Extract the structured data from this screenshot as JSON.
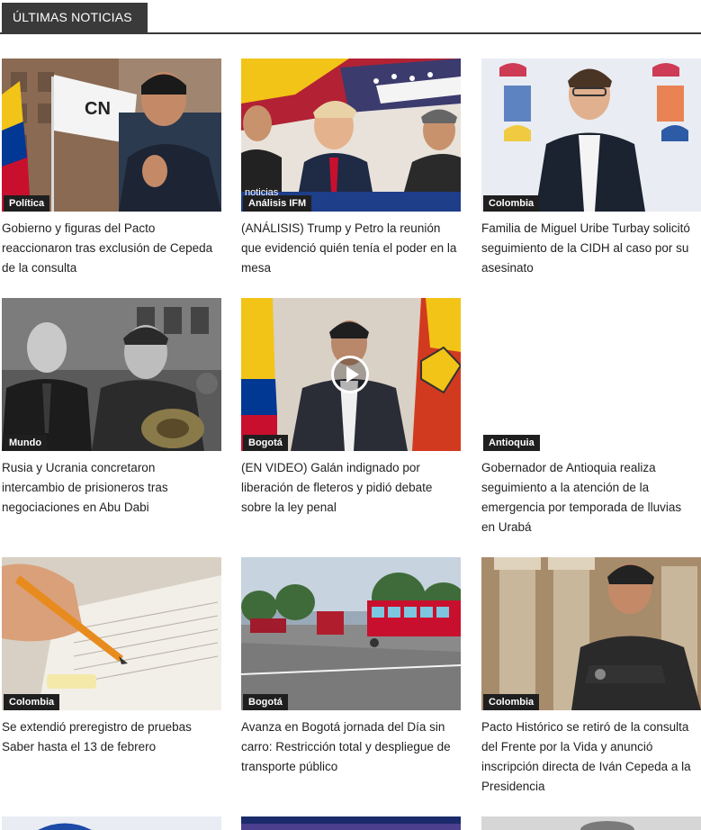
{
  "section": {
    "title": "ÚLTIMAS NOTICIAS"
  },
  "articles": [
    {
      "category": "Política",
      "headline": "Gobierno y figuras del Pacto reaccionaron tras exclusión de Cepeda de la consulta"
    },
    {
      "category": "Análisis IFM",
      "headline": "(ANÁLISIS) Trump y Petro la reunión que evidenció quién tenía el poder en la mesa"
    },
    {
      "category": "Colombia",
      "headline": "Familia de Miguel Uribe Turbay solicitó seguimiento de la CIDH al caso por su asesinato"
    },
    {
      "category": "Mundo",
      "headline": "Rusia y Ucrania concretaron intercambio de prisioneros tras negociaciones en Abu Dabi"
    },
    {
      "category": "Bogotá",
      "headline": "(EN VIDEO) Galán indignado por liberación de fleteros y pidió debate sobre la ley penal"
    },
    {
      "category": "Antioquia",
      "headline": "Gobernador de Antioquia realiza seguimiento a la atención de la emergencia por temporada de lluvias en Urabá"
    },
    {
      "category": "Colombia",
      "headline": "Se extendió preregistro de pruebas Saber hasta el 13 de febrero"
    },
    {
      "category": "Bogotá",
      "headline": "Avanza en Bogotá jornada del Día sin carro: Restricción total y despliegue de transporte público"
    },
    {
      "category": "Colombia",
      "headline": "Pacto Histórico se retiró de la consulta del Frente por la Vida y anunció inscripción directa de Iván Cepeda a la Presidencia"
    }
  ],
  "thumb_overlay_text": {
    "a1": "CN",
    "a2": "noticias"
  },
  "colors": {
    "header_bg": "#3a3a3a",
    "badge_bg": "#1f1f1f",
    "text": "#222222"
  },
  "icons": {
    "video": "play-icon"
  }
}
